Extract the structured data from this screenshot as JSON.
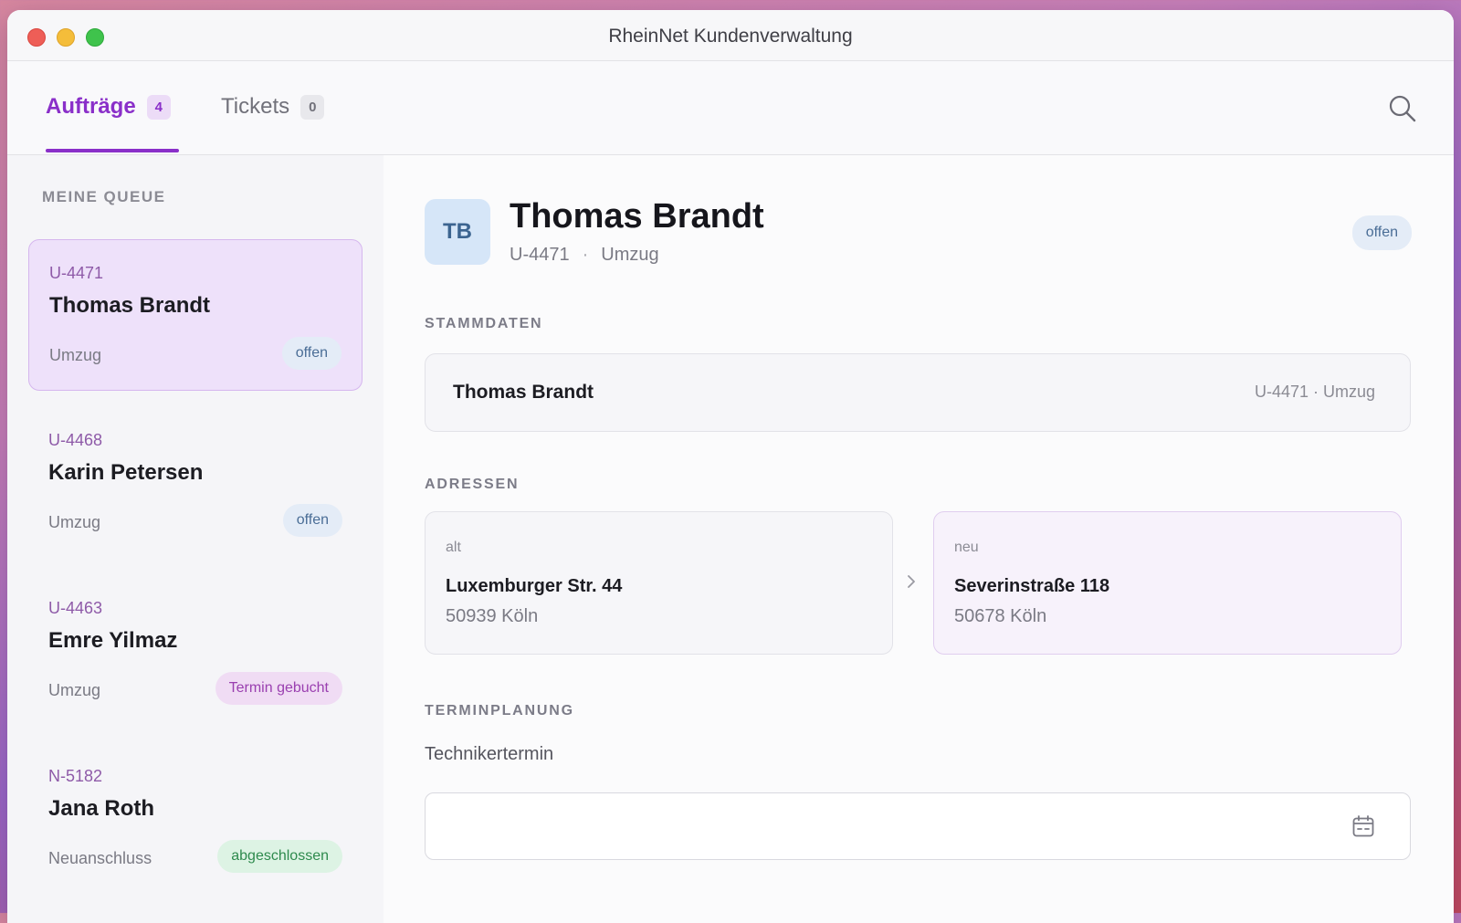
{
  "window": {
    "title": "RheinNet Kundenverwaltung"
  },
  "tabs": [
    {
      "label": "Aufträge",
      "count": "4",
      "active": true
    },
    {
      "label": "Tickets",
      "count": "0",
      "active": false
    }
  ],
  "toolbar": {
    "search_icon": "search-icon"
  },
  "sidebar": {
    "heading": "MEINE QUEUE",
    "items": [
      {
        "id": "U-4471",
        "name": "Thomas Brandt",
        "type": "Umzug",
        "status": "offen",
        "active": true
      },
      {
        "id": "U-4468",
        "name": "Karin Petersen",
        "type": "Umzug",
        "status": "offen",
        "active": false
      },
      {
        "id": "U-4463",
        "name": "Emre Yilmaz",
        "type": "Umzug",
        "status": "Termin gebucht",
        "active": false
      },
      {
        "id": "N-5182",
        "name": "Jana Roth",
        "type": "Neuanschluss",
        "status": "abgeschlossen",
        "active": false
      }
    ]
  },
  "detail": {
    "initials": "TB",
    "name": "Thomas Brandt",
    "id": "U-4471",
    "separator": "·",
    "type": "Umzug",
    "status": "offen",
    "stammdaten": {
      "heading": "STAMMDATEN",
      "name": "Thomas Brandt",
      "meta": "U-4471 · Umzug"
    },
    "adressen": {
      "heading": "ADRESSEN",
      "old": {
        "label": "alt",
        "street": "Luxemburger Str. 44",
        "city": "50939 Köln"
      },
      "new": {
        "label": "neu",
        "street": "Severinstraße 118",
        "city": "50678 Köln"
      }
    },
    "terminplanung": {
      "heading": "TERMINPLANUNG",
      "field_label": "Technikertermin",
      "value": ""
    }
  },
  "colors": {
    "accent": "#8a2fc9",
    "open_badge": "#e4ecf7",
    "termin_badge": "#f0dcf4",
    "done_badge": "#ddf3e4"
  }
}
